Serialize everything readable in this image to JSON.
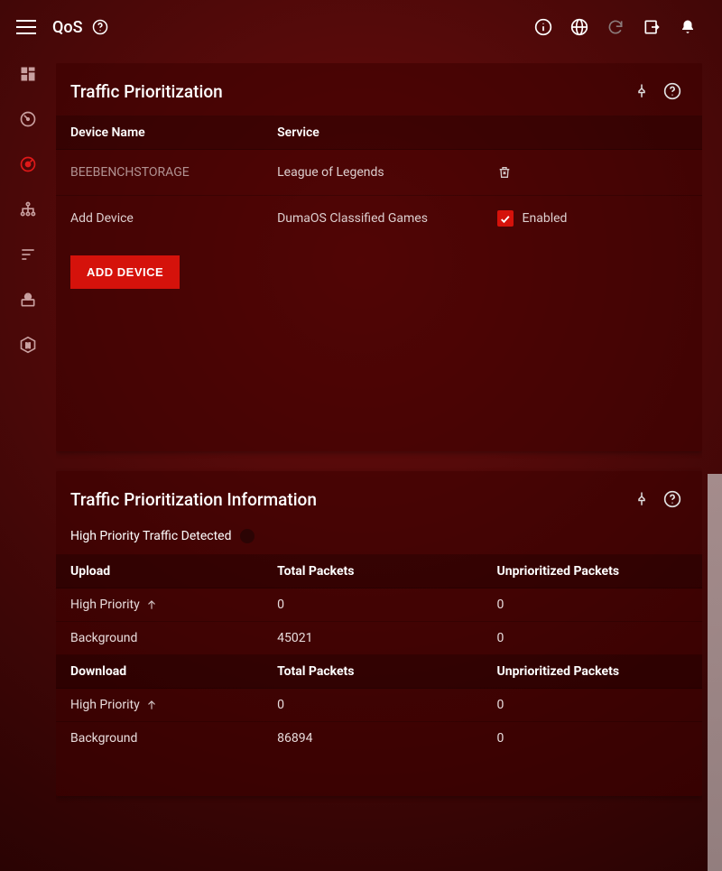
{
  "header": {
    "title": "QoS"
  },
  "cards": {
    "traffic": {
      "title": "Traffic Prioritization",
      "columns": {
        "device": "Device Name",
        "service": "Service"
      },
      "rows": [
        {
          "device": "BEEBENCHSTORAGE",
          "service": "League of Legends",
          "delete": true
        },
        {
          "device": "Add Device",
          "service": "DumaOS Classified Games",
          "enabled_label": "Enabled",
          "enabled": true
        }
      ],
      "add_button": "ADD DEVICE"
    },
    "info": {
      "title": "Traffic Prioritization Information",
      "status": "High Priority Traffic Detected",
      "sections": [
        {
          "name": "Upload",
          "col_total": "Total Packets",
          "col_unprio": "Unprioritized Packets",
          "rows": [
            {
              "label": "High Priority",
              "arrow": true,
              "total": "0",
              "unprio": "0"
            },
            {
              "label": "Background",
              "arrow": false,
              "total": "45021",
              "unprio": "0"
            }
          ]
        },
        {
          "name": "Download",
          "col_total": "Total Packets",
          "col_unprio": "Unprioritized Packets",
          "rows": [
            {
              "label": "High Priority",
              "arrow": true,
              "total": "0",
              "unprio": "0"
            },
            {
              "label": "Background",
              "arrow": false,
              "total": "86894",
              "unprio": "0"
            }
          ]
        }
      ]
    }
  }
}
